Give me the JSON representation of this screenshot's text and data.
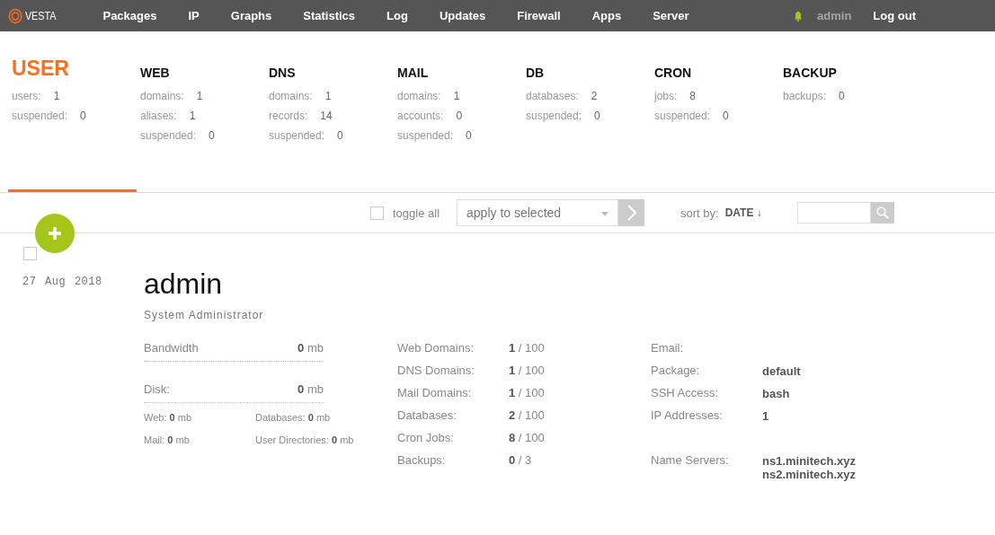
{
  "nav": {
    "logo": "VESTA",
    "items": [
      "Packages",
      "IP",
      "Graphs",
      "Statistics",
      "Log",
      "Updates",
      "Firewall",
      "Apps",
      "Server"
    ],
    "user": "admin",
    "logout": "Log out"
  },
  "stats": [
    {
      "title": "USER",
      "selected": true,
      "items": [
        {
          "label": "users:",
          "value": "1"
        },
        {
          "label": "suspended:",
          "value": "0"
        }
      ]
    },
    {
      "title": "WEB",
      "selected": false,
      "items": [
        {
          "label": "domains:",
          "value": "1"
        },
        {
          "label": "aliases:",
          "value": "1"
        },
        {
          "label": "suspended:",
          "value": "0"
        }
      ]
    },
    {
      "title": "DNS",
      "selected": false,
      "items": [
        {
          "label": "domains:",
          "value": "1"
        },
        {
          "label": "records:",
          "value": "14"
        },
        {
          "label": "suspended:",
          "value": "0"
        }
      ]
    },
    {
      "title": "MAIL",
      "selected": false,
      "items": [
        {
          "label": "domains:",
          "value": "1"
        },
        {
          "label": "accounts:",
          "value": "0"
        },
        {
          "label": "suspended:",
          "value": "0"
        }
      ]
    },
    {
      "title": "DB",
      "selected": false,
      "items": [
        {
          "label": "databases:",
          "value": "2"
        },
        {
          "label": "suspended:",
          "value": "0"
        }
      ]
    },
    {
      "title": "CRON",
      "selected": false,
      "items": [
        {
          "label": "jobs:",
          "value": "8"
        },
        {
          "label": "suspended:",
          "value": "0"
        }
      ]
    },
    {
      "title": "BACKUP",
      "selected": false,
      "items": [
        {
          "label": "backups:",
          "value": "0"
        }
      ]
    }
  ],
  "toolbar": {
    "toggle_all": {
      "label": "toggle all",
      "checked": false
    },
    "action": "apply to selected",
    "sort_label": "sort by:",
    "sort_value": "DATE ↓"
  },
  "user": {
    "checked": false,
    "date": "27 Aug 2018",
    "name": "admin",
    "role": "System Administrator",
    "usage": [
      {
        "label": "Bandwidth",
        "value": "**0** mb"
      },
      {
        "label": "Disk:",
        "value": "**0** mb",
        "details": [
          "Web: **0** mb",
          "Databases: **0** mb",
          "Mail: **0** mb",
          "User Directories: **0** mb"
        ]
      }
    ],
    "limits": [
      {
        "label": "Web Domains:",
        "value": "**1** / 100"
      },
      {
        "label": "DNS Domains:",
        "value": "**1** / 100"
      },
      {
        "label": "Mail Domains:",
        "value": "**1** / 100"
      },
      {
        "label": "Databases:",
        "value": "**2** / 100"
      },
      {
        "label": "Cron Jobs:",
        "value": "**8** / 100"
      },
      {
        "label": "Backups:",
        "value": "**0** / 3"
      }
    ],
    "info": [
      {
        "label": "Email:"
      },
      {
        "label": "Package:",
        "values": [
          "default"
        ]
      },
      {
        "label": "SSH Access:",
        "values": [
          "bash"
        ]
      },
      {
        "label": "IP Addresses:",
        "values": [
          "1"
        ]
      },
      {
        "label": "Name Servers:",
        "values": [
          "ns1.minitech.xyz",
          "ns2.minitech.xyz"
        ]
      }
    ]
  }
}
